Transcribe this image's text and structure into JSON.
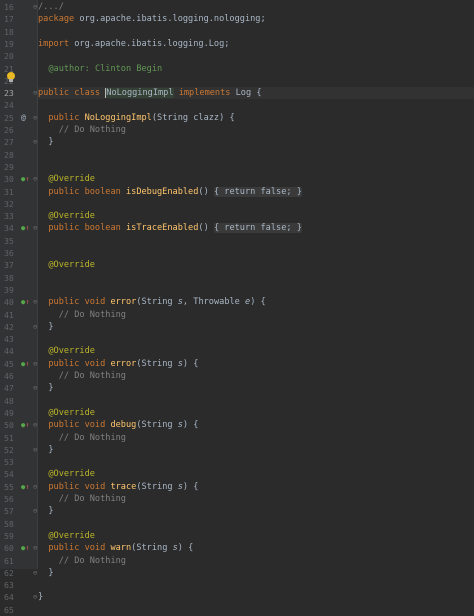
{
  "gutter": {
    "line_numbers": [
      "16",
      "17",
      "18",
      "19",
      "20",
      "21",
      "22",
      "23",
      "24",
      "25",
      "26",
      "27",
      "28",
      "29",
      "30",
      "31",
      "32",
      "33",
      "34",
      "35",
      "36",
      "37",
      "38",
      "39",
      "40",
      "41",
      "42",
      "43",
      "44",
      "45",
      "46",
      "47",
      "48",
      "49",
      "50",
      "51",
      "52",
      "53",
      "54",
      "55",
      "56",
      "57",
      "58",
      "59",
      "60",
      "61",
      "62",
      "63",
      "64",
      "65"
    ],
    "current_line": "23"
  },
  "code": {
    "l16": "/.../",
    "l17_kw": "package",
    "l17_pkg": " org.apache.ibatis.logging.nologging;",
    "l19_kw": "import",
    "l19_pkg": " org.apache.ibatis.logging.Log;",
    "l21_tag": "@author:",
    "l21_val": " Clinton Begin",
    "l23_kw": "public class ",
    "l23_cls": "NoLoggingImpl",
    "l23_impl": " implements ",
    "l23_iface": "Log {",
    "l25_kw": "public ",
    "l25_fn": "NoLoggingImpl",
    "l25_args": "(String clazz) {",
    "do_nothing": "// Do Nothing",
    "close_brace": "}",
    "override": "@Override",
    "l30_kw": "public boolean ",
    "l30_fn": "isDebugEnabled",
    "l30_rest": "() ",
    "fold_body": "{ return false; }",
    "l34_fn": "isTraceEnabled",
    "pv_kw": "public void ",
    "fn_error": "error",
    "args_error2": "(String s, Throwable e) {",
    "args_s_open": "(String ",
    "args_s_name": "s",
    "args_s_close": ") {",
    "args_e_mid": ", Throwable ",
    "args_e_name": "e",
    "fn_debug": "debug",
    "fn_trace": "trace",
    "fn_warn": "warn",
    "l64": "}"
  },
  "colors": {
    "background": "#2b2b2b",
    "gutter": "#313335",
    "keyword": "#cc7832",
    "method": "#ffc66d",
    "comment": "#808080",
    "doc": "#629755",
    "annotation": "#bbb529",
    "text": "#a9b7c6"
  }
}
